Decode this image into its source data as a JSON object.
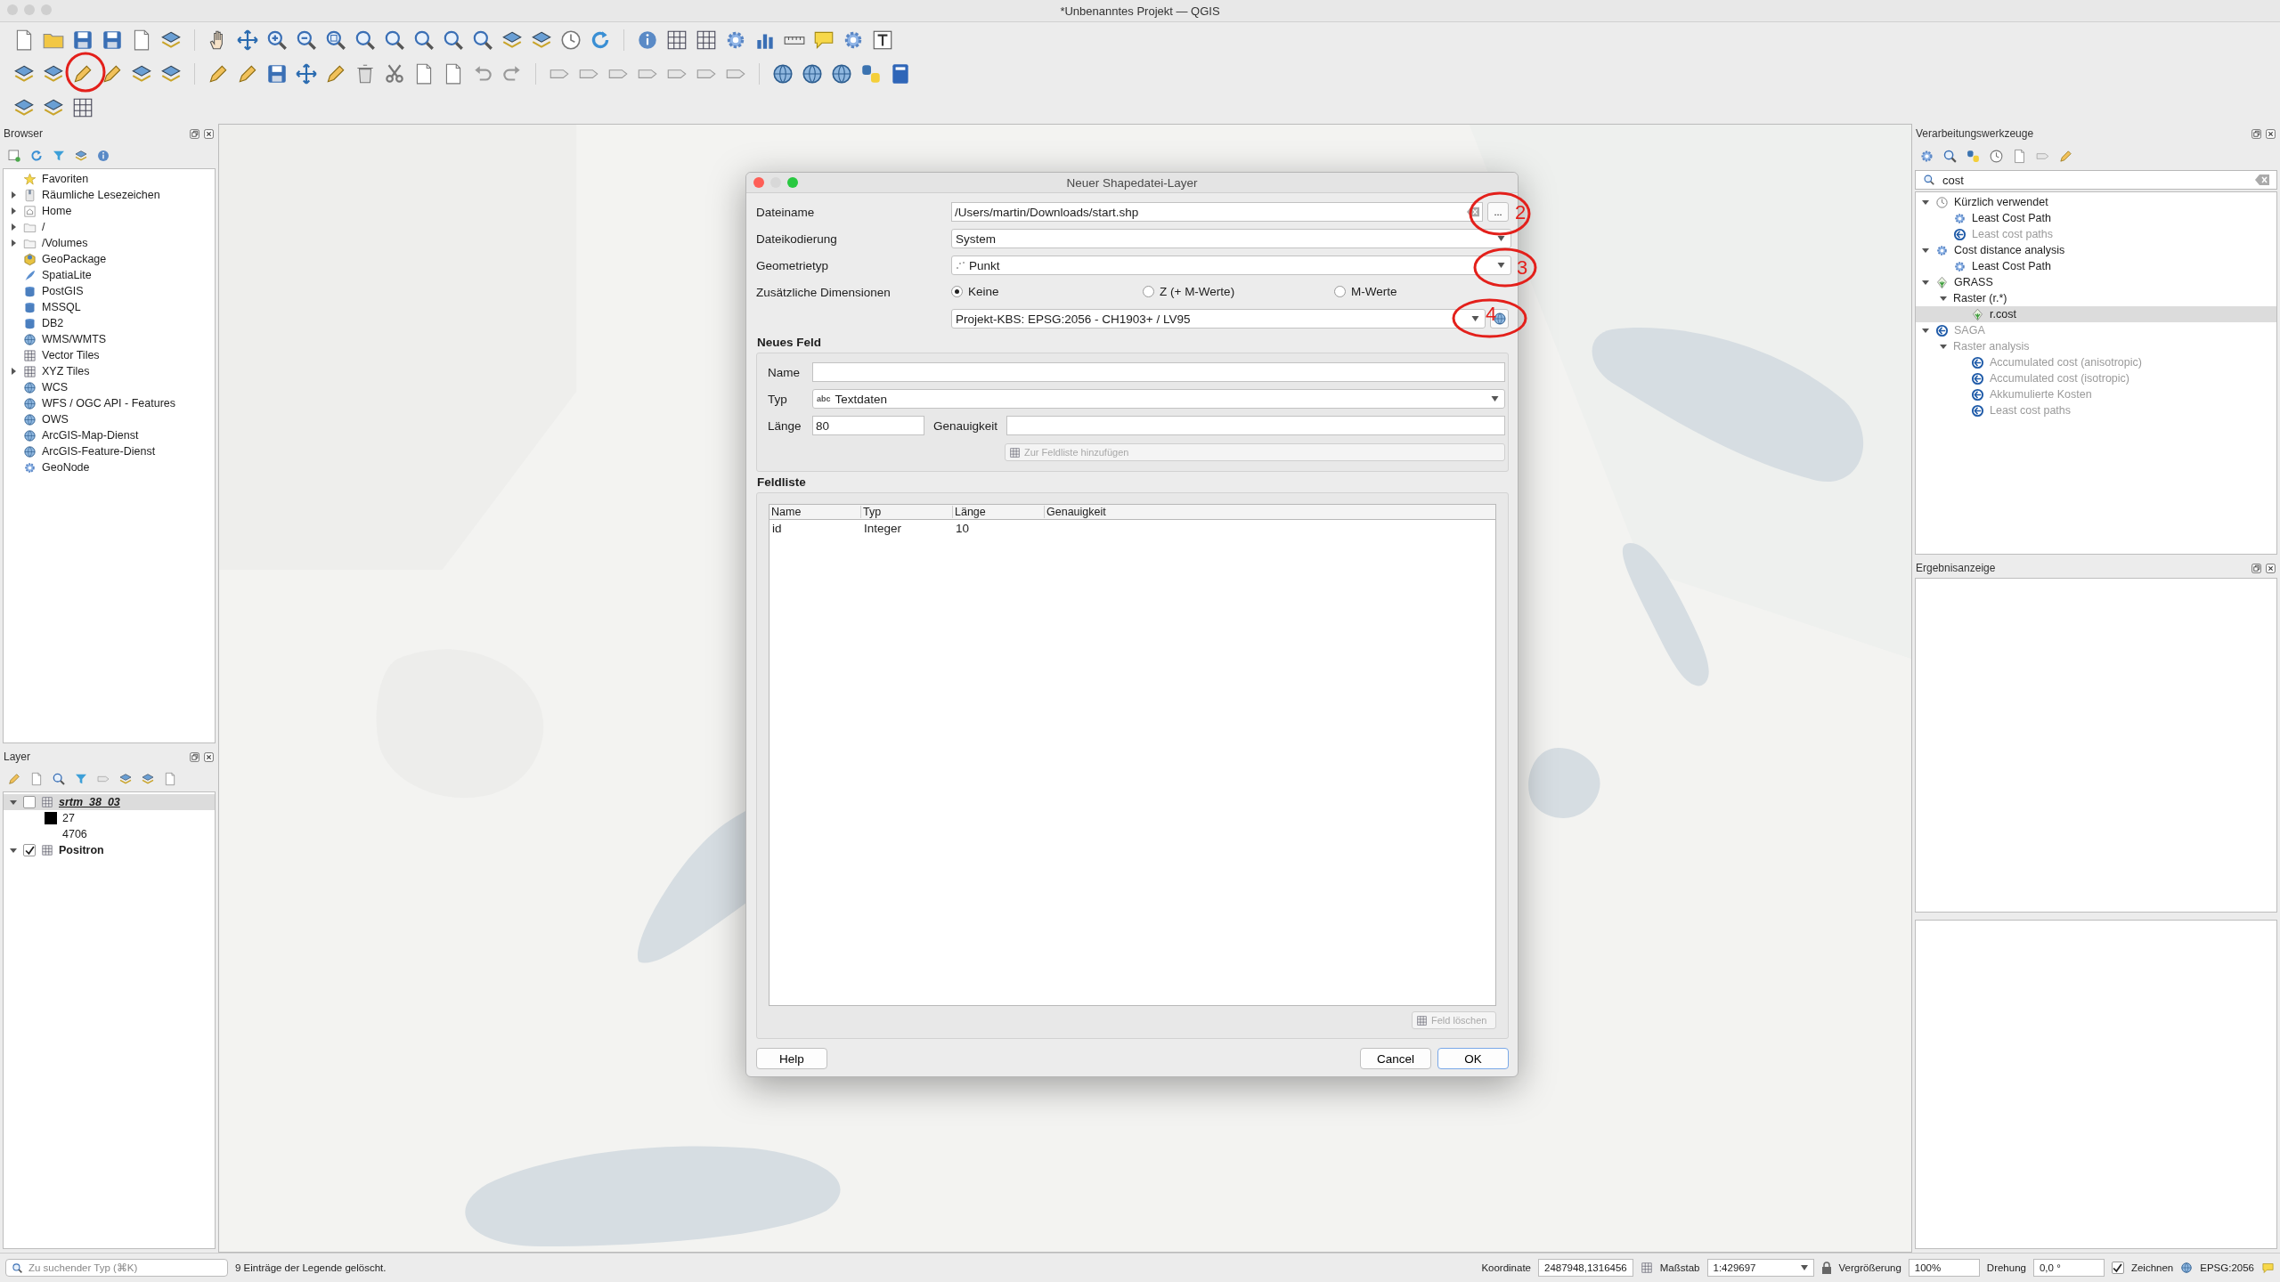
{
  "window": {
    "title": "*Unbenanntes Projekt — QGIS"
  },
  "browser": {
    "title": "Browser",
    "items": [
      {
        "label": "Favoriten",
        "has_children": false
      },
      {
        "label": "Räumliche Lesezeichen",
        "has_children": true
      },
      {
        "label": "Home",
        "has_children": true
      },
      {
        "label": "/",
        "has_children": true
      },
      {
        "label": "/Volumes",
        "has_children": true
      },
      {
        "label": "GeoPackage",
        "has_children": false
      },
      {
        "label": "SpatiaLite",
        "has_children": false
      },
      {
        "label": "PostGIS",
        "has_children": false
      },
      {
        "label": "MSSQL",
        "has_children": false
      },
      {
        "label": "DB2",
        "has_children": false
      },
      {
        "label": "WMS/WMTS",
        "has_children": false
      },
      {
        "label": "Vector Tiles",
        "has_children": false
      },
      {
        "label": "XYZ Tiles",
        "has_children": true
      },
      {
        "label": "WCS",
        "has_children": false
      },
      {
        "label": "WFS / OGC API - Features",
        "has_children": false
      },
      {
        "label": "OWS",
        "has_children": false
      },
      {
        "label": "ArcGIS-Map-Dienst",
        "has_children": false
      },
      {
        "label": "ArcGIS-Feature-Dienst",
        "has_children": false
      },
      {
        "label": "GeoNode",
        "has_children": false
      }
    ]
  },
  "layers": {
    "title": "Layer",
    "items": [
      {
        "name": "srtm_38_03",
        "checked": false,
        "expanded": true,
        "selected": true,
        "legend": [
          {
            "label": "27",
            "color": "#000000"
          },
          {
            "label": "4706"
          }
        ]
      },
      {
        "name": "Positron",
        "checked": true,
        "expanded": true,
        "selected": false
      }
    ]
  },
  "processing": {
    "title": "Verarbeitungswerkzeuge",
    "search": "cost",
    "tree": [
      {
        "label": "Kürzlich verwendet",
        "kind": "history",
        "expanded": true,
        "disabled": false,
        "selected": false,
        "children": [
          {
            "label": "Least Cost Path",
            "kind": "native",
            "disabled": false,
            "selected": false
          },
          {
            "label": "Least cost paths",
            "kind": "saga",
            "disabled": true,
            "selected": false
          }
        ]
      },
      {
        "label": "Cost distance analysis",
        "kind": "native",
        "expanded": true,
        "disabled": false,
        "selected": false,
        "children": [
          {
            "label": "Least Cost Path",
            "kind": "native",
            "disabled": false,
            "selected": false
          }
        ]
      },
      {
        "label": "GRASS",
        "kind": "grass",
        "expanded": true,
        "disabled": false,
        "selected": false,
        "children": [
          {
            "label": "Raster (r.*)",
            "kind": "group",
            "expanded": true,
            "disabled": false,
            "selected": false,
            "children": [
              {
                "label": "r.cost",
                "kind": "grass",
                "disabled": false,
                "selected": true
              }
            ]
          }
        ]
      },
      {
        "label": "SAGA",
        "kind": "saga",
        "expanded": true,
        "disabled": true,
        "selected": false,
        "children": [
          {
            "label": "Raster analysis",
            "kind": "group",
            "expanded": true,
            "disabled": true,
            "selected": false,
            "children": [
              {
                "label": "Accumulated cost (anisotropic)",
                "kind": "saga",
                "disabled": true,
                "selected": false
              },
              {
                "label": "Accumulated cost (isotropic)",
                "kind": "saga",
                "disabled": true,
                "selected": false
              },
              {
                "label": "Akkumulierte Kosten",
                "kind": "saga",
                "disabled": true,
                "selected": false
              },
              {
                "label": "Least cost paths",
                "kind": "saga",
                "disabled": true,
                "selected": false
              }
            ]
          }
        ]
      }
    ]
  },
  "results": {
    "title": "Ergebnisanzeige"
  },
  "dialog": {
    "title": "Neuer Shapedatei-Layer",
    "filename": {
      "label": "Dateiname",
      "value": "/Users/martin/Downloads/start.shp",
      "browse": "..."
    },
    "encoding": {
      "label": "Dateikodierung",
      "value": "System"
    },
    "geometry": {
      "label": "Geometrietyp",
      "value": "Punkt"
    },
    "dimensions": {
      "label": "Zusätzliche Dimensionen",
      "options": [
        {
          "label": "Keine",
          "selected": true
        },
        {
          "label": "Z (+ M-Werte)",
          "selected": false
        },
        {
          "label": "M-Werte",
          "selected": false
        }
      ]
    },
    "crs": {
      "value": "Projekt-KBS: EPSG:2056 - CH1903+ / LV95"
    },
    "new_field": {
      "heading": "Neues Feld",
      "name_label": "Name",
      "type_label": "Typ",
      "type_badge": "abc",
      "type_value": "Textdaten",
      "length_label": "Länge",
      "length_value": "80",
      "precision_label": "Genauigkeit",
      "add_button": {
        "label": "Zur Feldliste hinzufügen",
        "disabled": true
      }
    },
    "field_list": {
      "heading": "Feldliste",
      "columns": [
        "Name",
        "Typ",
        "Länge",
        "Genauigkeit"
      ],
      "rows": [
        {
          "cells": [
            "id",
            "Integer",
            "10"
          ]
        }
      ],
      "remove_button": {
        "label": "Feld löschen",
        "disabled": true
      }
    },
    "buttons": [
      {
        "label": "Help",
        "default": false
      },
      {
        "label": "Cancel",
        "default": false
      },
      {
        "label": "OK",
        "default": true
      }
    ]
  },
  "annotations": [
    {
      "number": "2"
    },
    {
      "number": "3"
    },
    {
      "number": "4"
    }
  ],
  "status_bar": {
    "search_placeholder": "Zu suchender Typ (⌘K)",
    "message": "9 Einträge der Legende gelöscht.",
    "coordinate_label": "Koordinate",
    "coordinate": "2487948,1316456",
    "scale_label": "Maßstab",
    "scale": "1:429697",
    "magnifier_label": "Vergrößerung",
    "magnifier": "100%",
    "rotation_label": "Drehung",
    "rotation": "0,0 °",
    "render_label": "Zeichnen",
    "render_checked": true,
    "crs": "EPSG:2056"
  }
}
